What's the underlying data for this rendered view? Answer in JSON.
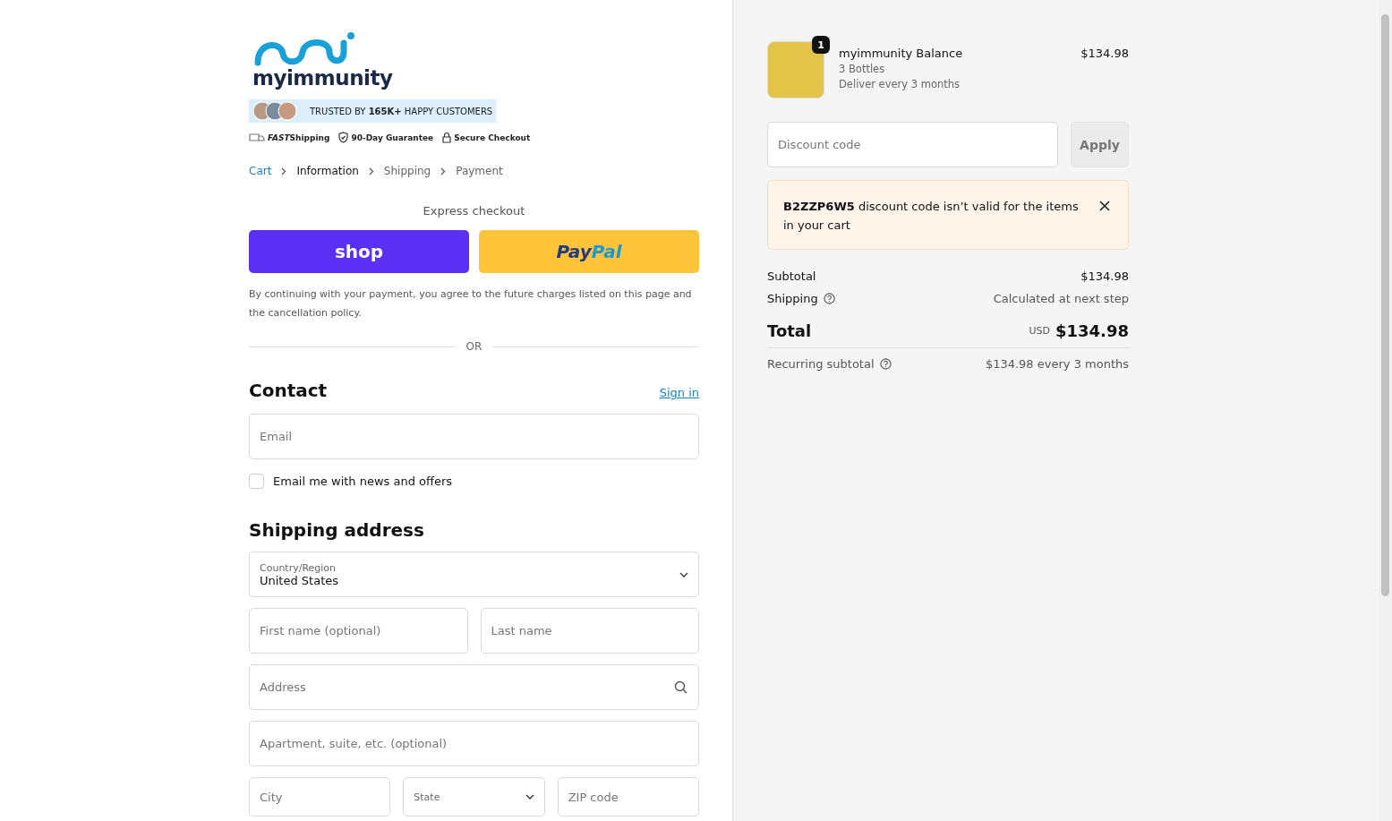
{
  "brand": {
    "logo_text": "myimmunity",
    "trust_badge": {
      "prefix": "TRUSTED BY ",
      "highlight": "165K+",
      "suffix": " HAPPY CUSTOMERS"
    },
    "perks": [
      {
        "kind": "truck",
        "emphasis": "FAST",
        "text": "Shipping"
      },
      {
        "kind": "shield",
        "text": "90-Day Guarantee"
      },
      {
        "kind": "lock",
        "text": "Secure Checkout"
      }
    ]
  },
  "breadcrumbs": [
    {
      "label": "Cart",
      "selected": false,
      "link": true
    },
    {
      "label": "Information",
      "selected": true,
      "link": false
    },
    {
      "label": "Shipping",
      "selected": false,
      "link": false
    },
    {
      "label": "Payment",
      "selected": false,
      "link": false
    }
  ],
  "express_checkout": {
    "title": "Express checkout",
    "buttons": [
      {
        "kind": "shop",
        "label": "shop"
      },
      {
        "kind": "paypal",
        "label": "Pay",
        "label_2": "Pal"
      }
    ],
    "notice": "By continuing with your payment, you agree to the future charges listed on this page and the cancellation policy.",
    "divider": "OR"
  },
  "contact": {
    "title": "Contact",
    "sign_in": "Sign in",
    "email": {
      "placeholder": "Email"
    },
    "newsletter": {
      "label": "Email me with news and offers",
      "checked": false
    }
  },
  "shipping_address": {
    "title": "Shipping address",
    "rows": [
      [
        {
          "kind": "select",
          "label": "Country/Region",
          "value": "United States"
        }
      ],
      [
        {
          "kind": "text",
          "placeholder": "First name (optional)"
        },
        {
          "kind": "text",
          "placeholder": "Last name"
        }
      ],
      [
        {
          "kind": "search",
          "placeholder": "Address"
        }
      ],
      [
        {
          "kind": "text",
          "placeholder": "Apartment, suite, etc. (optional)"
        }
      ],
      [
        {
          "kind": "text",
          "placeholder": "City"
        },
        {
          "kind": "select",
          "label": "State"
        },
        {
          "kind": "text",
          "placeholder": "ZIP code"
        }
      ]
    ]
  },
  "order_summary": {
    "items": [
      {
        "name": "myimmunity Balance",
        "quantity": "1",
        "variant": "3 Bottles",
        "plan": "Deliver every 3 months",
        "price": "$134.98"
      }
    ],
    "discount": {
      "placeholder": "Discount code",
      "button": "Apply",
      "error": "**B2ZZP6W5** discount code isn’t valid for the items in your cart"
    },
    "subtotal": {
      "label": "Subtotal",
      "value": "$134.98"
    },
    "shipping": {
      "label": "Shipping",
      "value": "Calculated at next step"
    },
    "total": {
      "label": "Total",
      "currency": "USD",
      "value": "$134.98"
    },
    "recurring": {
      "label": "Recurring subtotal",
      "value": "$134.98 every 3 months"
    }
  }
}
